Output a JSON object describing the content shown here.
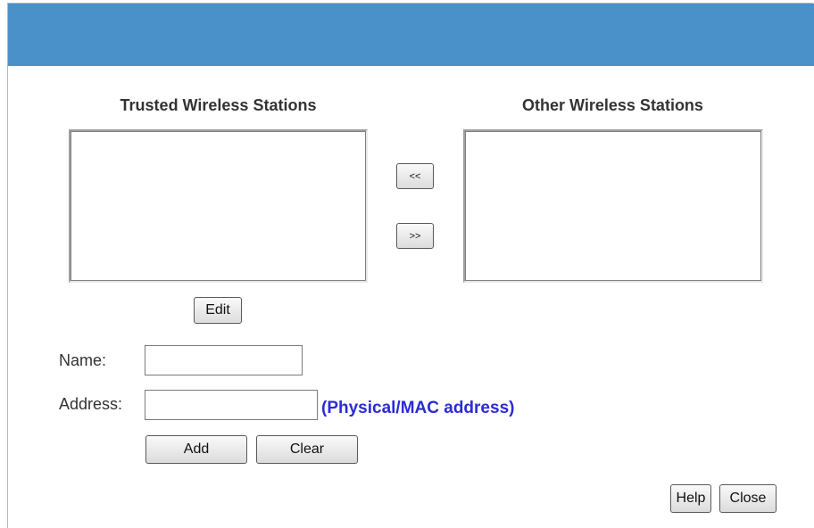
{
  "header": {
    "color": "#4a90c9"
  },
  "lists": {
    "trusted_title": "Trusted Wireless Stations",
    "other_title": "Other Wireless Stations",
    "trusted_items": [],
    "other_items": []
  },
  "buttons": {
    "move_left": "<<",
    "move_right": ">>",
    "edit": "Edit",
    "add": "Add",
    "clear": "Clear",
    "help": "Help",
    "close": "Close"
  },
  "form": {
    "name_label": "Name:",
    "name_value": "",
    "address_label": "Address:",
    "address_value": "",
    "address_hint": "(Physical/MAC address)"
  },
  "colors": {
    "hint": "#2b2bd6"
  }
}
